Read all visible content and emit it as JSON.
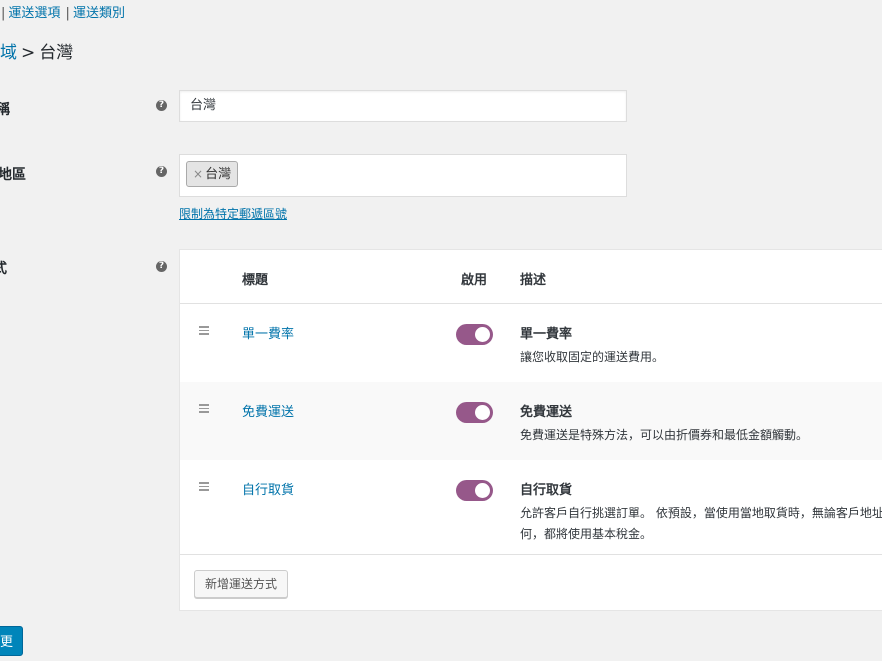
{
  "subnav": {
    "separator": "|",
    "items": [
      {
        "label": "運送選項"
      },
      {
        "label": "運送類別"
      }
    ]
  },
  "breadcrumb": {
    "parent": "域",
    "separator": ">",
    "current": "台灣"
  },
  "form": {
    "zone_name": {
      "label": "稱",
      "value": "台灣"
    },
    "zone_regions": {
      "label": "地區",
      "chip": "台灣",
      "chip_remove": "×",
      "postcode_link": "限制為特定郵遞區號"
    },
    "shipping_methods": {
      "label": "式"
    },
    "help_glyph": "?"
  },
  "methods_table": {
    "headers": {
      "title": "標題",
      "enabled": "啟用",
      "description": "描述"
    },
    "rows": [
      {
        "title": "單一費率",
        "enabled": true,
        "desc_title": "單一費率",
        "desc_text": "讓您收取固定的運送費用。"
      },
      {
        "title": "免費運送",
        "enabled": true,
        "desc_title": "免費運送",
        "desc_text": "免費運送是特殊方法，可以由折價券和最低金額觸動。"
      },
      {
        "title": "自行取貨",
        "enabled": true,
        "desc_title": "自行取貨",
        "desc_text": "允許客戶自行挑選訂單。 依預設，當使用當地取貨時，無論客戶地址為何，都將使用基本稅金。"
      }
    ],
    "add_button": "新增運送方式"
  },
  "save_button": "變更",
  "colors": {
    "link": "#0073aa",
    "toggle_on": "#96588a",
    "primary": "#0085ba"
  }
}
